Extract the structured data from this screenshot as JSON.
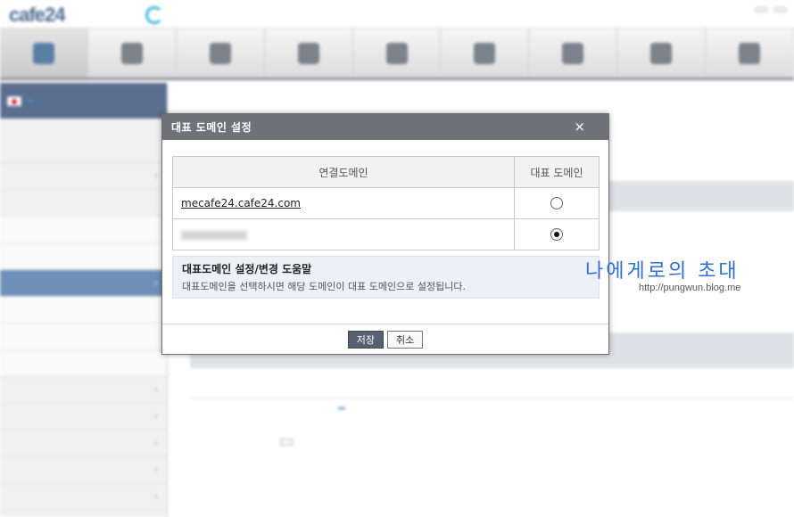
{
  "dialog": {
    "title": "대표 도메인 설정",
    "close_glyph": "×",
    "table": {
      "headers": [
        "연결도메인",
        "대표 도메인"
      ],
      "rows": [
        {
          "domain": "mecafe24.cafe24.com",
          "selected": false
        },
        {
          "domain": "",
          "selected": true
        }
      ]
    },
    "help": {
      "title": "대표도메인 설정/변경 도움말",
      "text": "대표도메인을 선택하시면 해당 도메인이 대표 도메인으로 설정됩니다."
    },
    "buttons": {
      "save": "저장",
      "cancel": "취소"
    }
  },
  "background_app": {
    "logo": "cafe24",
    "logo_icon": "cafe24-c-logo-icon",
    "menu_count": 9,
    "active_menu_index": 0,
    "sidebar_active_index": 4,
    "colors": {
      "header": "#6f7278",
      "save_button": "#566071",
      "help_bg": "#eef0f7",
      "watermark": "#2f6fd4"
    }
  },
  "watermark": {
    "title": "나에게로의 초대",
    "url": "http://pungwun.blog.me"
  }
}
